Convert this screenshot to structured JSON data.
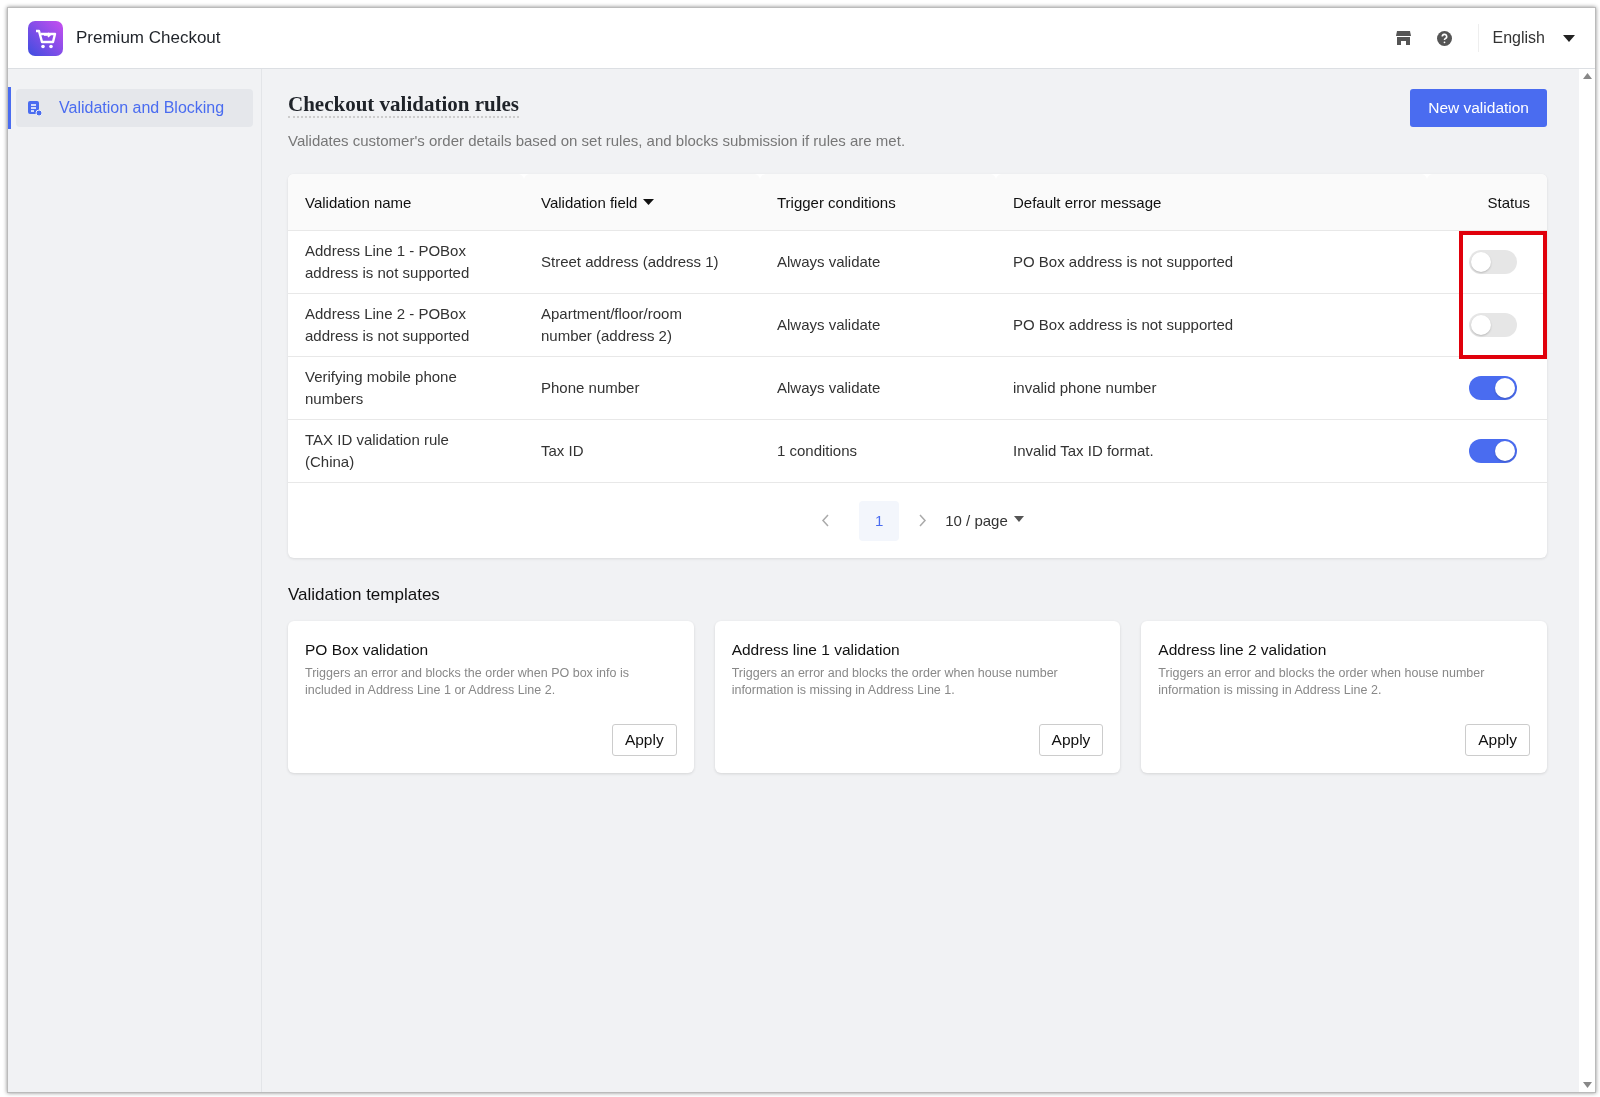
{
  "header": {
    "app_name": "Premium Checkout",
    "language": "English"
  },
  "sidebar": {
    "items": [
      {
        "label": "Validation and Blocking",
        "selected": true
      }
    ]
  },
  "page": {
    "title": "Checkout validation rules",
    "description": "Validates customer's order details based on set rules, and blocks submission if rules are met.",
    "new_button": "New validation"
  },
  "table": {
    "columns": [
      "Validation name",
      "Validation field",
      "Trigger conditions",
      "Default error message",
      "Status"
    ],
    "rows": [
      {
        "name": "Address Line 1 - POBox address is not supported",
        "field": "Street address (address 1)",
        "trigger": "Always validate",
        "message": "PO Box address is not supported",
        "on": false,
        "highlighted": true
      },
      {
        "name": "Address Line 2 - POBox address is not supported",
        "field": "Apartment/floor/room number (address 2)",
        "trigger": "Always validate",
        "message": "PO Box address is not supported",
        "on": false,
        "highlighted": true
      },
      {
        "name": "Verifying mobile phone numbers",
        "field": "Phone number",
        "trigger": "Always validate",
        "message": "invalid phone number",
        "on": true,
        "highlighted": false
      },
      {
        "name": "TAX ID validation rule (China)",
        "field": "Tax ID",
        "trigger": "1 conditions",
        "message": "Invalid Tax ID format.",
        "on": true,
        "highlighted": false
      }
    ],
    "pagination": {
      "pages": [
        {
          "label": "1",
          "selected": true
        }
      ],
      "page_size": "10 / page"
    }
  },
  "templates": {
    "title": "Validation templates",
    "cards": [
      {
        "title": "PO Box validation",
        "description": "Triggers an error and blocks the order when PO box info is included in Address Line 1 or Address Line 2.",
        "button": "Apply"
      },
      {
        "title": "Address line 1 validation",
        "description": "Triggers an error and blocks the order when house number information is missing in Address Line 1.",
        "button": "Apply"
      },
      {
        "title": "Address line 2 validation",
        "description": "Triggers an error and blocks the order when house number information is missing in Address Line 2.",
        "button": "Apply"
      }
    ]
  }
}
